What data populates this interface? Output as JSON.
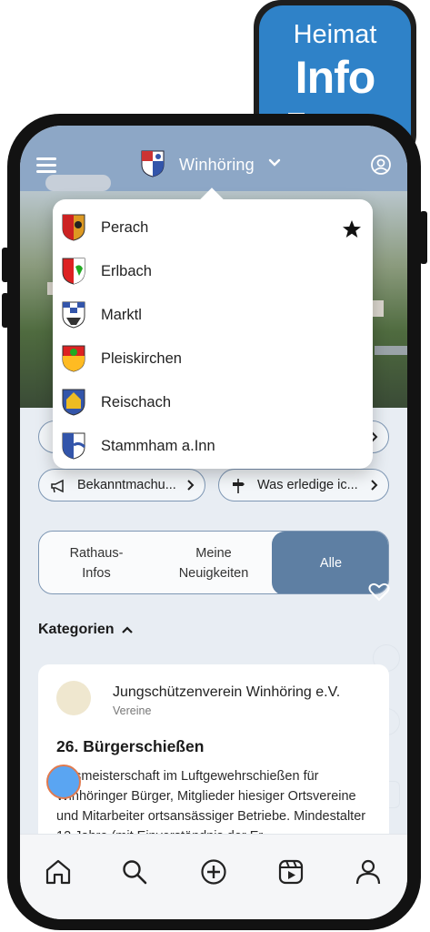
{
  "badge": {
    "line1": "Heimat",
    "line2": "Info"
  },
  "header": {
    "town": "Winhöring"
  },
  "dropdown": {
    "items": [
      {
        "label": "Perach",
        "favorite": true
      },
      {
        "label": "Erlbach"
      },
      {
        "label": "Marktl"
      },
      {
        "label": "Pleiskirchen"
      },
      {
        "label": "Reischach"
      },
      {
        "label": "Stammham a.Inn"
      }
    ]
  },
  "chips": {
    "row2": [
      {
        "label": "Bekanntmachu...",
        "icon": "megaphone-icon"
      },
      {
        "label": "Was erledige ic...",
        "icon": "signpost-icon"
      }
    ]
  },
  "segments": [
    {
      "label": "Rathaus-\nInfos"
    },
    {
      "label": "Meine\nNeuigkeiten"
    },
    {
      "label": "Alle",
      "active": true
    }
  ],
  "categories_label": "Kategorien",
  "card": {
    "org": "Jungschützenverein Winhöring e.V.",
    "category": "Vereine",
    "title": "26. Bürgerschießen",
    "body": "Ortsmeisterschaft im Luftgewehrschießen für Winhöringer Bürger, Mitglieder hiesiger Ortsvereine und Mitarbeiter ortsansässiger Betriebe. Mindestalter 12 Jahre (mit Einverständnis der Er"
  },
  "colors": {
    "header": "#8da7c6",
    "accent": "#5e7fa3",
    "badge": "#2f82c8"
  }
}
